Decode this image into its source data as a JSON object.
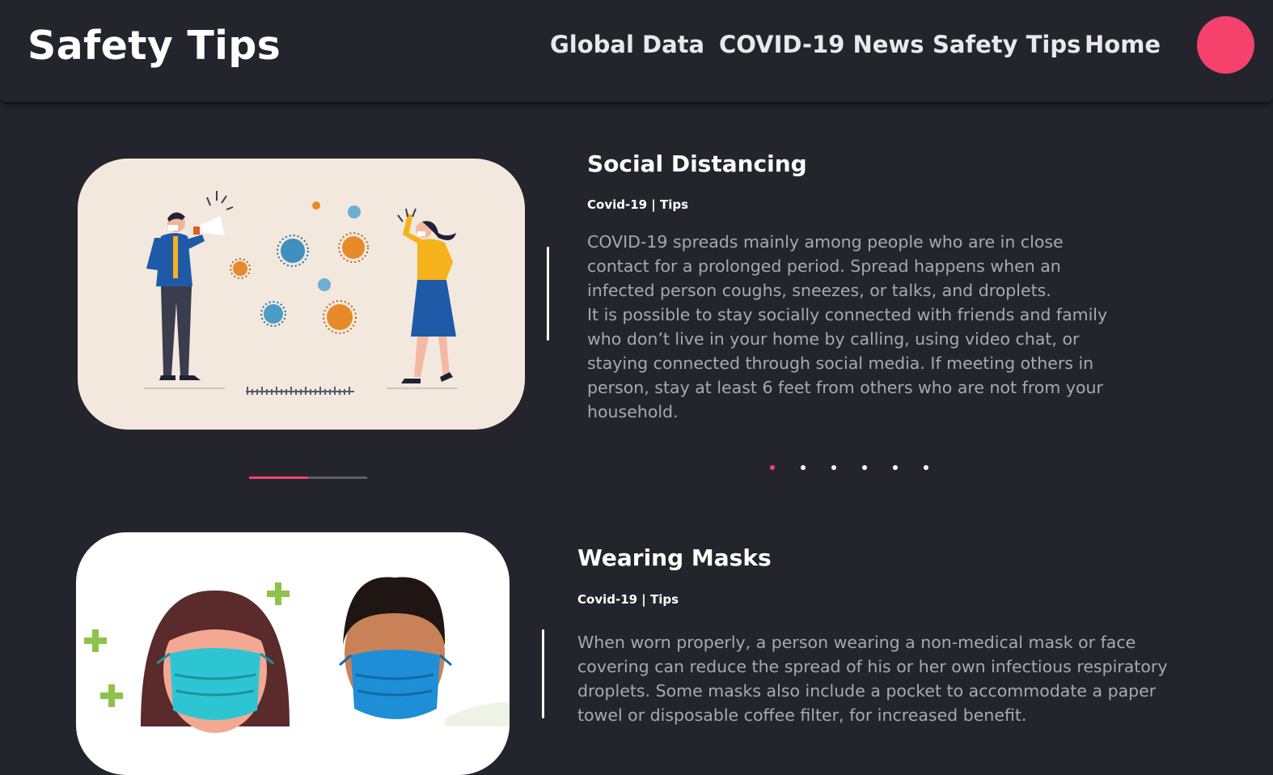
{
  "header": {
    "brand": "Safety Tips",
    "nav": [
      {
        "label": "Global Data"
      },
      {
        "label": "COVID-19 News"
      },
      {
        "label": "Safety Tips"
      },
      {
        "label": "Home"
      }
    ],
    "avatar_color": "#f5426c"
  },
  "cards": [
    {
      "title": "Social Distancing",
      "category": "Covid-19 | Tips",
      "body": [
        "COVID-19 spreads mainly among people who are in close",
        "contact for a prolonged period. Spread happens when an",
        "infected person coughs, sneezes, or talks, and droplets.",
        "It is possible to stay socially connected with friends and family",
        "who don’t live in your home by calling, using video chat, or",
        "staying connected through social media. If meeting others in",
        "person, stay at least 6 feet from others who are not from your",
        "household."
      ]
    },
    {
      "title": "Wearing Masks",
      "category": "Covid-19 | Tips",
      "body": [
        "When worn properly, a person wearing a non-medical mask or face",
        "covering can reduce the spread of his or her own infectious respiratory",
        "droplets. Some masks also include a pocket to accommodate a paper",
        "towel or disposable coffee filter, for increased benefit."
      ]
    }
  ],
  "carousel": {
    "progress": 0.5,
    "dot_count": 6,
    "active_dot": 0
  },
  "colors": {
    "background": "#24252c",
    "accent": "#f5426c",
    "body_text": "#a7a8b2"
  }
}
